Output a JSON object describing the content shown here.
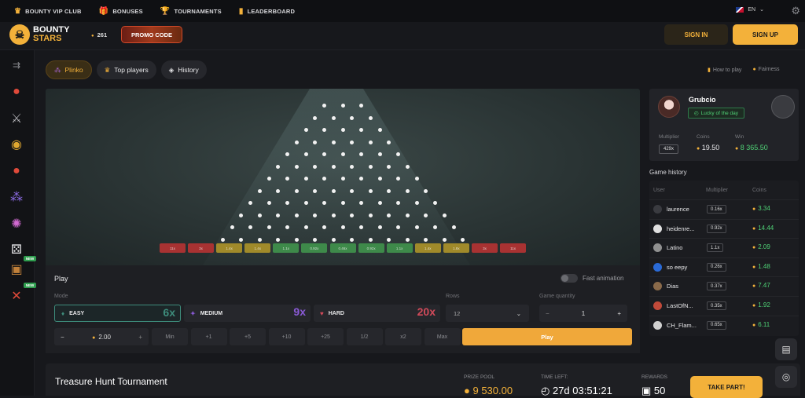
{
  "topnav": [
    {
      "label": "BOUNTY VIP CLUB",
      "icon": "crown-icon",
      "glyph": "♛"
    },
    {
      "label": "BONUSES",
      "icon": "gift-icon",
      "glyph": "🎁"
    },
    {
      "label": "TOURNAMENTS",
      "icon": "trophy-icon",
      "glyph": "🏆"
    },
    {
      "label": "LEADERBOARD",
      "icon": "bars-icon",
      "glyph": "▮"
    }
  ],
  "lang": {
    "code": "EN"
  },
  "logo": {
    "line1": "BOUNTY",
    "line2": "STARS"
  },
  "coins": "261",
  "promo_label": "PROMO CODE",
  "sign_in": "SIGN IN",
  "sign_up": "SIGN UP",
  "sidebar_new": "NEW",
  "tabs": [
    "Plinko",
    "Top players",
    "History"
  ],
  "how_to_play": "How to play",
  "fairness": "Fairness",
  "multipliers": [
    "11x",
    "3x",
    "1.4x",
    "1.4x",
    "1.1x",
    "0.92x",
    "0.46x",
    "0.92x",
    "1.1x",
    "1.4x",
    "1.8x",
    "3x",
    "11x"
  ],
  "play": {
    "title": "Play",
    "fast_animation": "Fast animation",
    "mode_label": "Mode",
    "rows_label": "Rows",
    "quantity_label": "Game quantity",
    "modes": [
      {
        "name": "EASY",
        "mult": "6x",
        "color": "#3e8d7c"
      },
      {
        "name": "MEDIUM",
        "mult": "9x",
        "color": "#8a5ad6"
      },
      {
        "name": "HARD",
        "mult": "20x",
        "color": "#d24a5a"
      }
    ],
    "rows_value": "12",
    "quantity_value": "1",
    "bet_value": "2.00",
    "chips": [
      "Min",
      "+1",
      "+5",
      "+10",
      "+25",
      "1/2",
      "x2",
      "Max"
    ],
    "play_button": "Play"
  },
  "lucky": {
    "name": "Grubcio",
    "badge": "Lucky of the day",
    "multiplier_label": "Multiplier",
    "coins_label": "Coins",
    "win_label": "Win",
    "multiplier": "429x",
    "coins": "19.50",
    "win": "8 365.50"
  },
  "game_history": {
    "title": "Game history",
    "headers": [
      "User",
      "Multiplier",
      "Coins"
    ],
    "rows": [
      {
        "user": "laurence",
        "mult": "0.16x",
        "coins": "3.34"
      },
      {
        "user": "heidenre...",
        "mult": "0.92x",
        "coins": "14.44"
      },
      {
        "user": "Latino",
        "mult": "1.1x",
        "coins": "2.09"
      },
      {
        "user": "so eepy",
        "mult": "0.26x",
        "coins": "1.48"
      },
      {
        "user": "Dias",
        "mult": "0.37x",
        "coins": "7.47"
      },
      {
        "user": "LastOfN...",
        "mult": "0.35x",
        "coins": "1.92"
      },
      {
        "user": "CH_Flam...",
        "mult": "0.65x",
        "coins": "6.11"
      }
    ]
  },
  "tournament": {
    "title": "Treasure Hunt Tournament",
    "prize_label": "PRIZE POOL",
    "prize": "9 530.00",
    "time_label": "TIME LEFT:",
    "time": "27d 03:51:21",
    "rewards_label": "REWARDS",
    "rewards": "50",
    "take_part": "TAKE PART!"
  }
}
